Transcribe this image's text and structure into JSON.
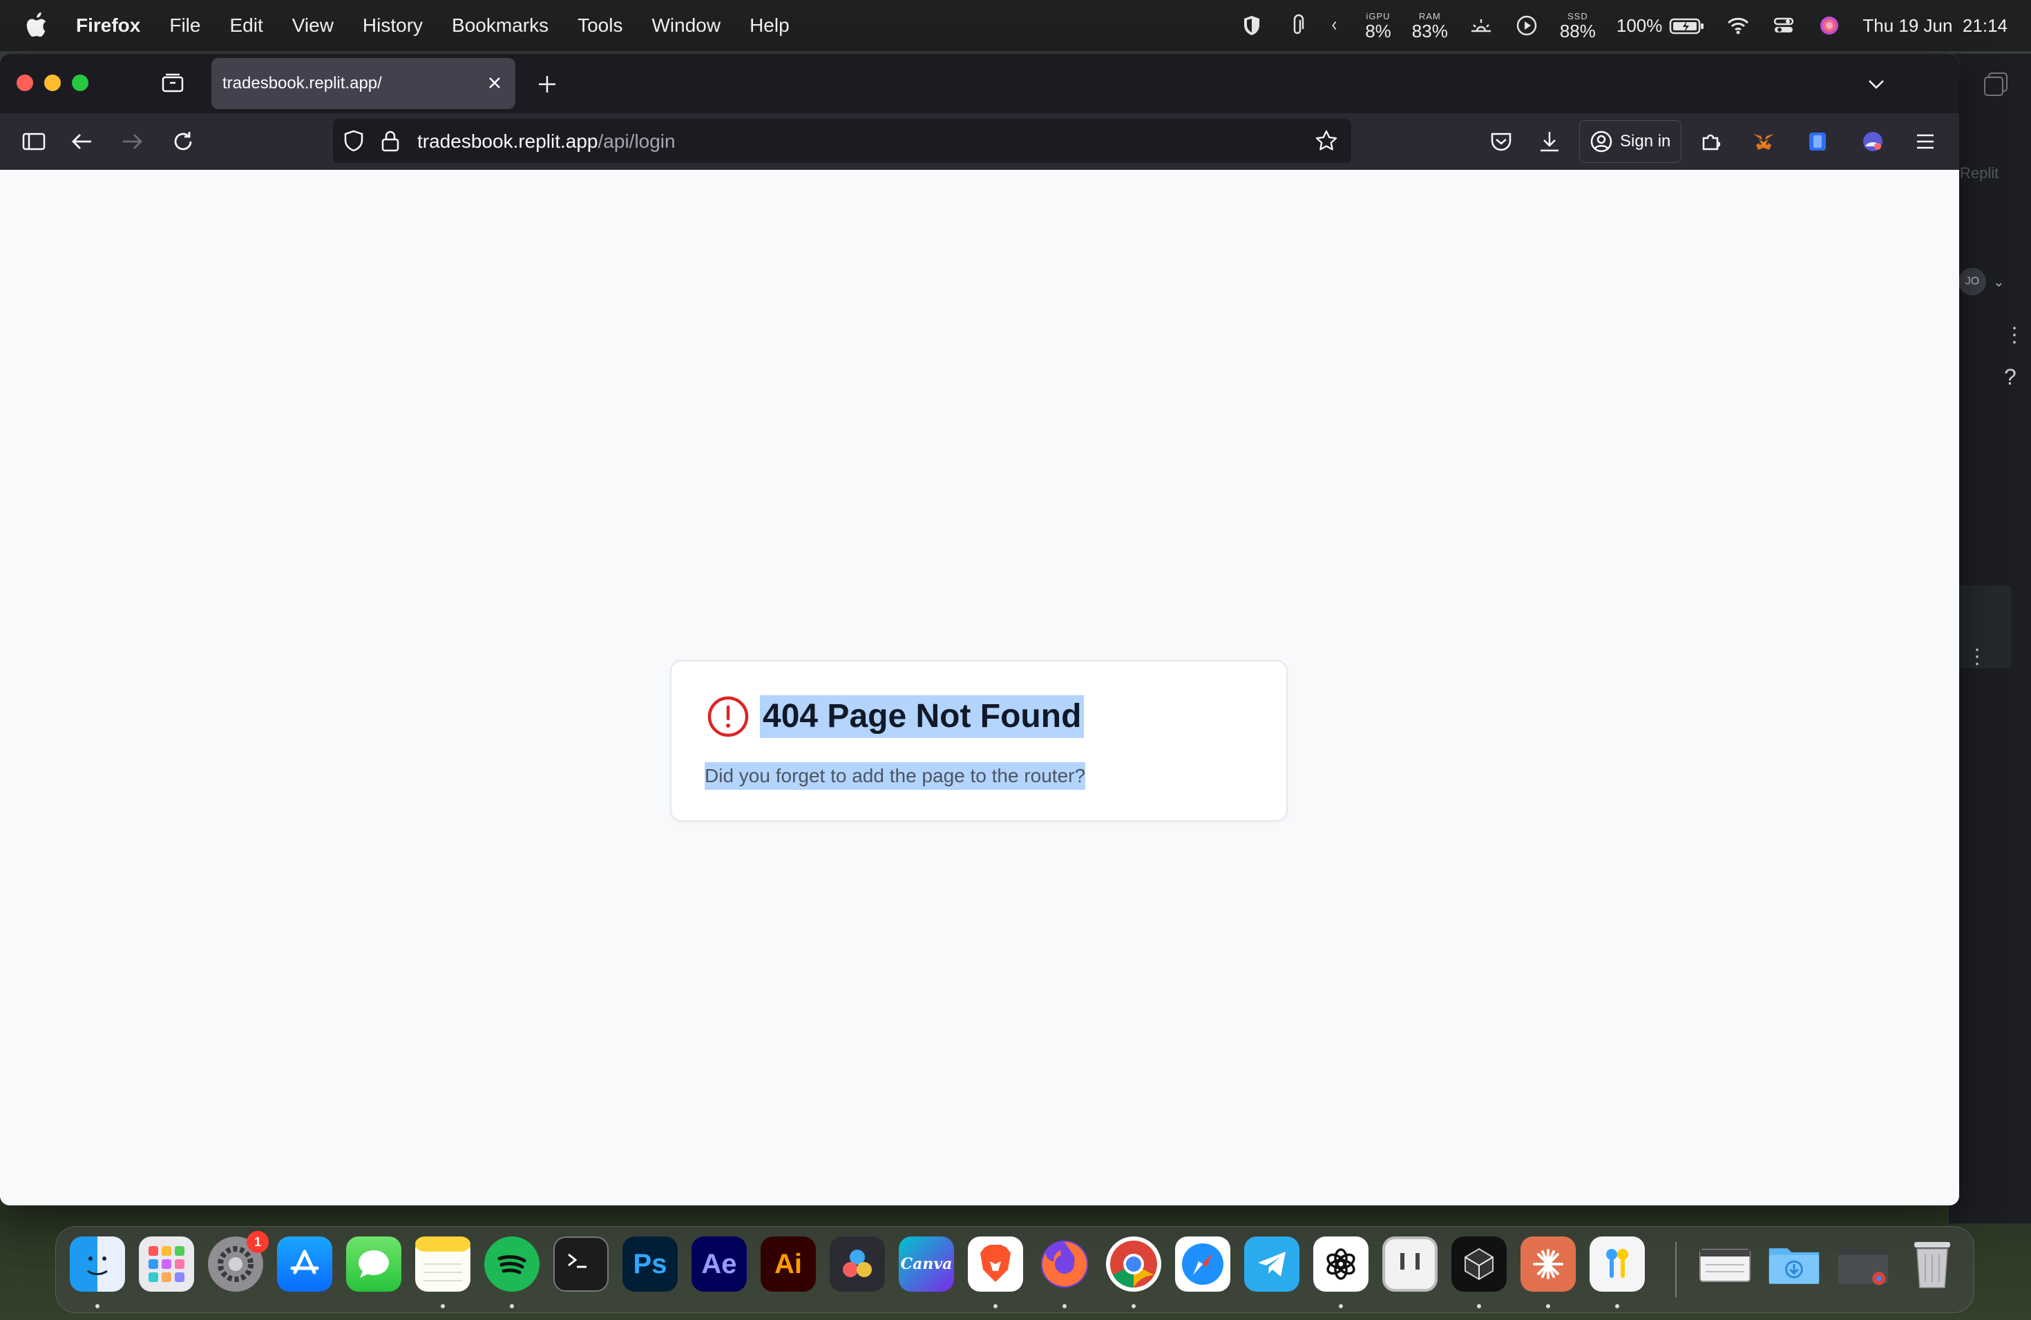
{
  "menubar": {
    "app_name": "Firefox",
    "menus": [
      "File",
      "Edit",
      "View",
      "History",
      "Bookmarks",
      "Tools",
      "Window",
      "Help"
    ],
    "stats": {
      "igpu": {
        "label": "iGPU",
        "value": "8%"
      },
      "ram": {
        "label": "RAM",
        "value": "83%"
      },
      "ssd": {
        "label": "SSD",
        "value": "88%"
      }
    },
    "battery_percent": "100%",
    "clock": "Thu 19 Jun  21:14"
  },
  "browser": {
    "tab_title": "tradesbook.replit.app/",
    "url_host": "tradesbook.replit.app",
    "url_path": "/api/login",
    "sign_in_label": "Sign in"
  },
  "page": {
    "heading": "404 Page Not Found",
    "message": "Did you forget to add the page to the router?",
    "alert_color": "#dc2626"
  },
  "background_window": {
    "title_fragment": "Replit",
    "avatar_initials": "JO"
  },
  "dock": {
    "settings_badge": "1",
    "apps": [
      "Finder",
      "Launchpad",
      "System Settings",
      "App Store",
      "Messages",
      "Notes",
      "Spotify",
      "Terminal",
      "Photoshop",
      "After Effects",
      "Illustrator",
      "DaVinci Resolve",
      "Canva",
      "Brave",
      "Firefox",
      "Chrome",
      "Safari",
      "Telegram",
      "ChatGPT",
      "Pastebot",
      "Cursor",
      "Claude",
      "Keychain",
      "Scanner",
      "Downloads",
      "Chrome Apps",
      "Trash"
    ],
    "labels": {
      "photoshop": "Ps",
      "after_effects": "Ae",
      "illustrator": "Ai",
      "canva": "Canva"
    }
  }
}
